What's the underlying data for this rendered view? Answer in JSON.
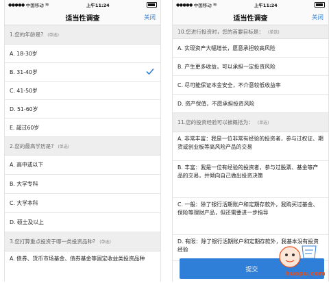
{
  "left": {
    "status": {
      "carrier": "中国移动",
      "wifi": "wifi",
      "time": "上午11:24"
    },
    "nav": {
      "title": "适当性调查",
      "close": "关闭"
    },
    "q1": {
      "title": "1.您的年龄是?",
      "tag": "(单选)",
      "options": [
        "A. 18-30岁",
        "B. 31-40岁",
        "C. 41-50岁",
        "D. 51-60岁",
        "E. 超过60岁"
      ],
      "selected_index": 1
    },
    "q2": {
      "title": "2.您的最高学历是?",
      "tag": "(单选)",
      "options": [
        "A. 高中或以下",
        "B. 大学专科",
        "C. 大学本科",
        "D. 硕士及以上"
      ]
    },
    "q3": {
      "title": "3.您打算重点投资于哪一类投资品种?",
      "tag": "(单选)",
      "options": [
        "A. 债券、货币市场基金、债券基金等固定收益类投资品种"
      ]
    }
  },
  "right": {
    "status": {
      "carrier": "中国移动",
      "wifi": "wifi",
      "time": "上午11:24"
    },
    "nav": {
      "title": "适当性调查",
      "close": "关闭"
    },
    "q10": {
      "title": "10.您进行投资时，您的首要目标是：",
      "tag": "(单选)",
      "options": [
        "A. 实现资产大幅增长，愿意承担较高风险",
        "B. 产生更多收益，可以承担一定投资风险",
        "C. 尽可能保证本金安全，不介意较低收益率",
        "D. 资产保值，不愿承担投资风险"
      ]
    },
    "q11": {
      "title": "11.您的投资经验可以被概括为：",
      "tag": "(单选)",
      "options": [
        "A. 非常丰富：我是一位非常有经验的投资者，参与过权证、期货或创业板等高风险产品的交易",
        "B. 丰富：我是一位有经验的投资者，参与过股票、基金等产品的交易，并倾向自己做出投资决策",
        "C. 一般：除了银行活期账户和定期存款外，我购买过基金、保险等理财产品，但还需要进一步指导",
        "D. 有限：除了银行活期账户和定期存款外，我基本没有投资经验"
      ]
    },
    "submit": "提交"
  },
  "watermark": {
    "site": "huopu.com"
  },
  "colors": {
    "accent": "#2f7fd8",
    "section_bg": "#eeeeef",
    "divider": "#e6e6e6",
    "watermark": "#e84e1b"
  }
}
